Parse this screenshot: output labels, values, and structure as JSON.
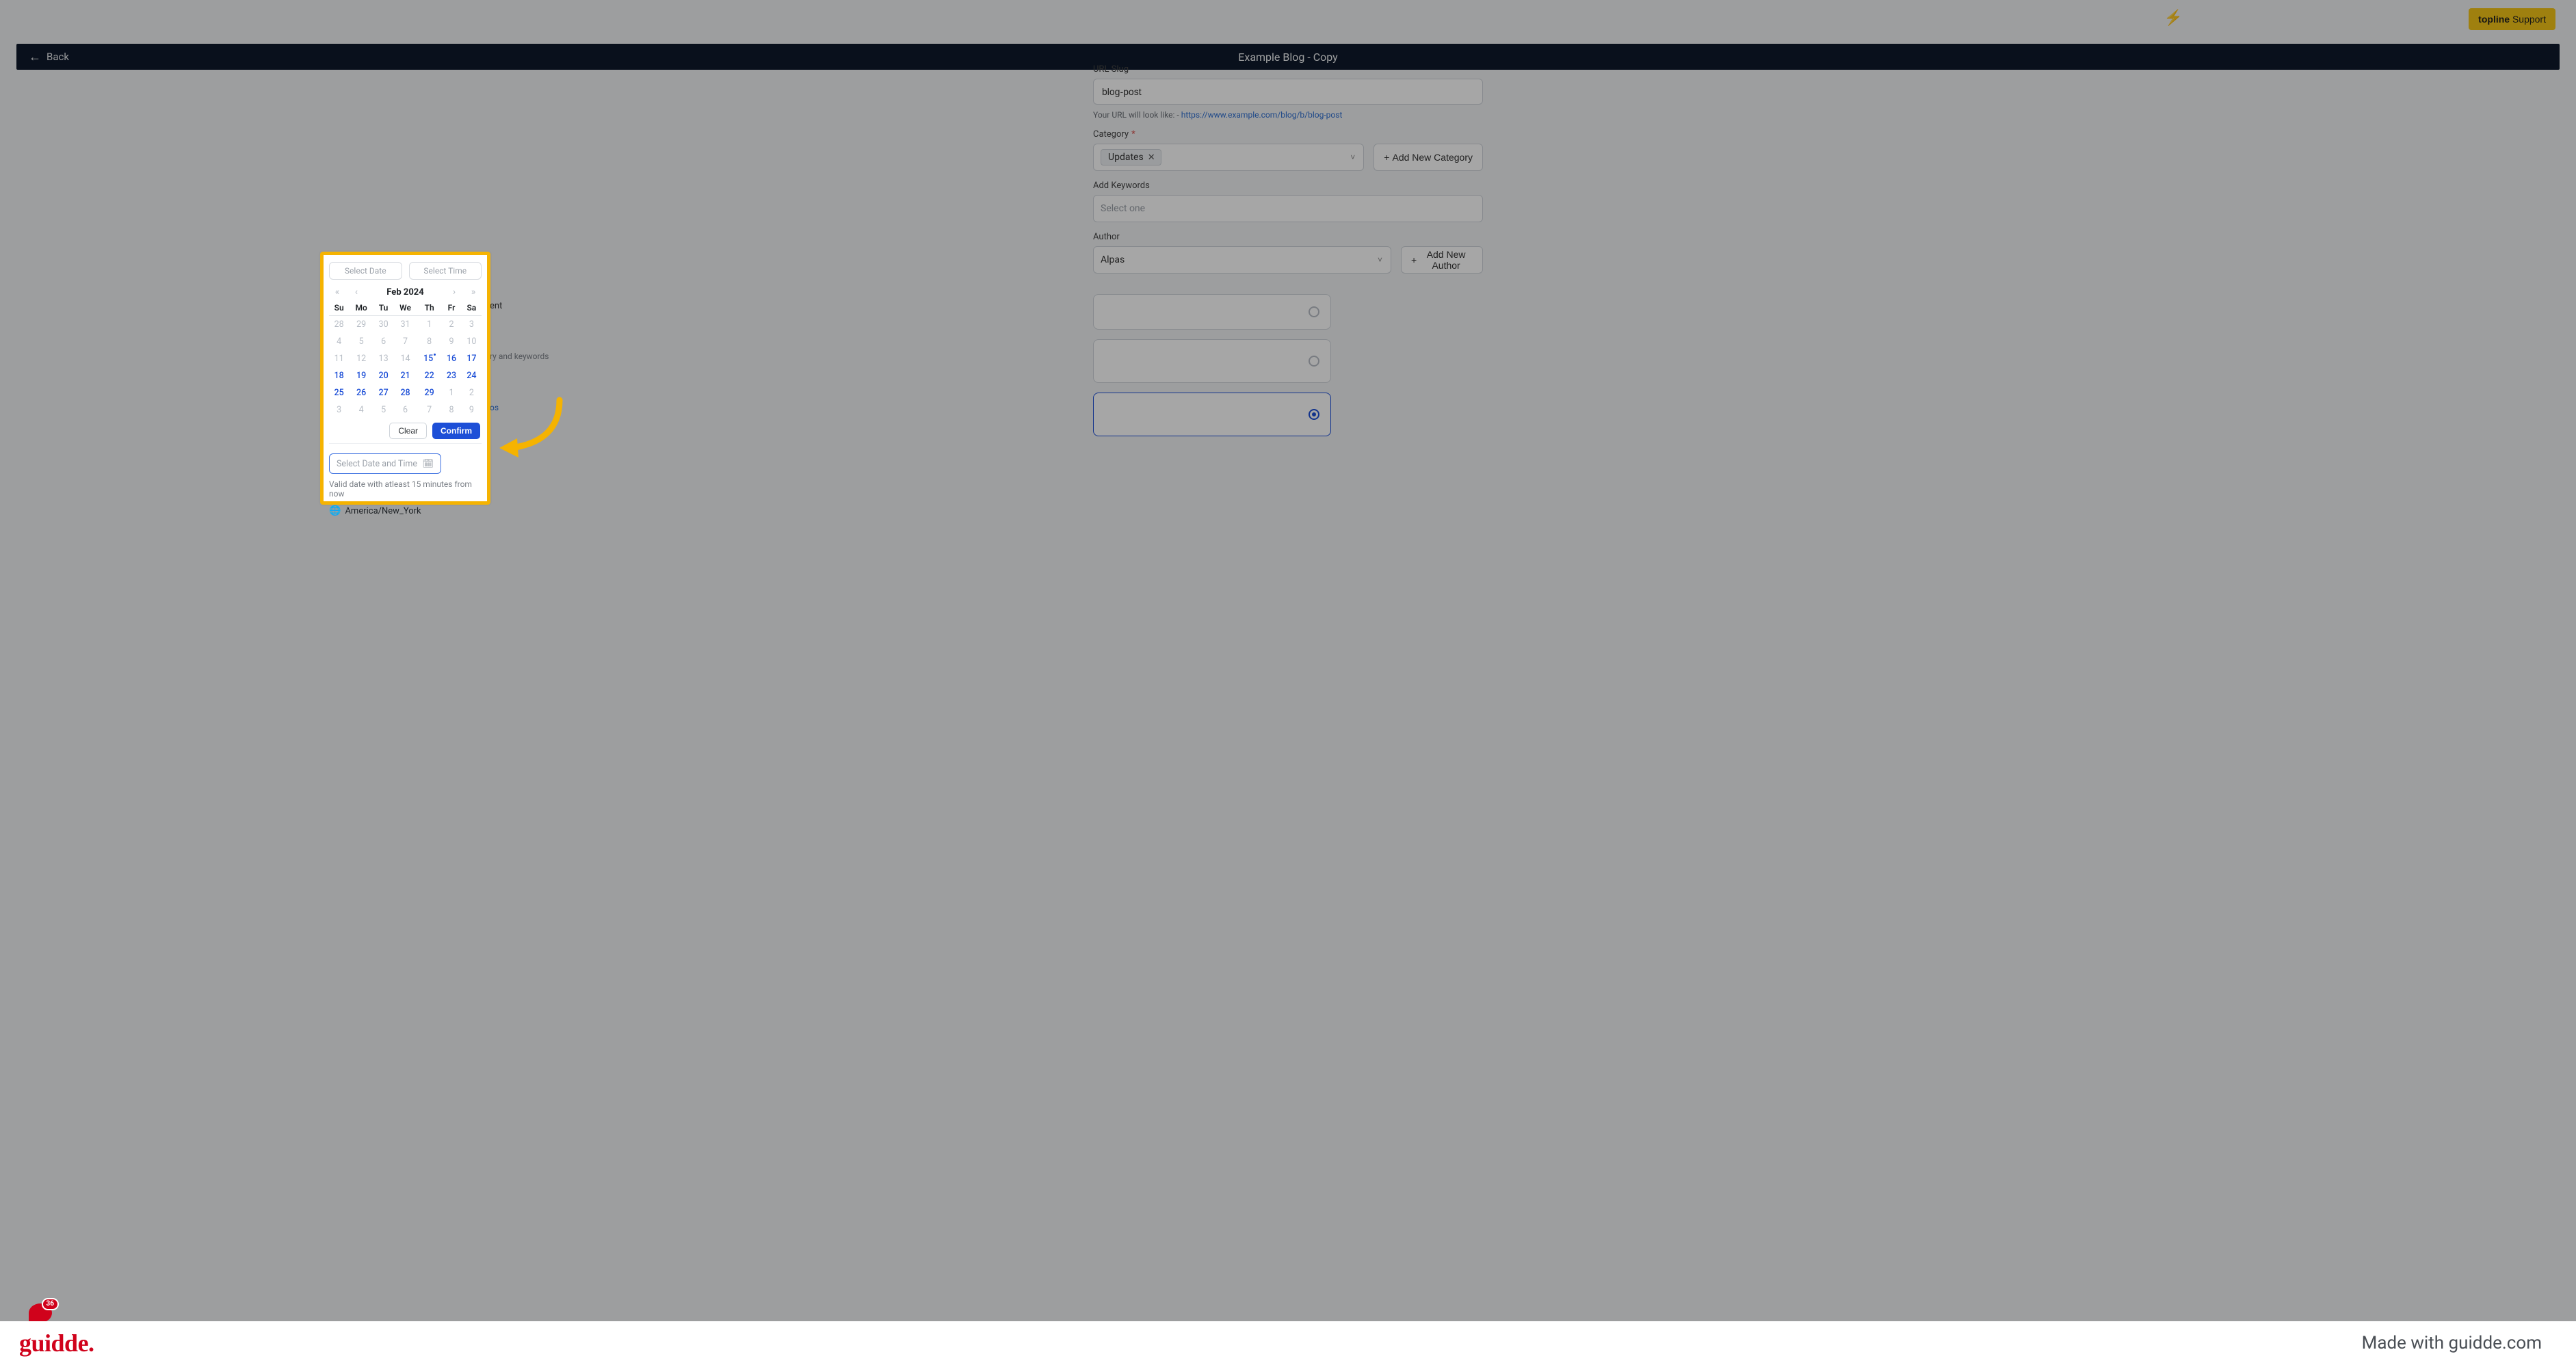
{
  "topbar": {
    "support_label_bold": "topline",
    "support_label_rest": " Support"
  },
  "header": {
    "back_label": "Back",
    "title": "Example Blog - Copy"
  },
  "form": {
    "url_slug_label": "URL Slug",
    "url_slug_value": "blog-post",
    "url_help_prefix": "Your URL will look like: - ",
    "url_help_link": "https://www.example.com/blog/b/blog-post",
    "category_label": "Category",
    "category_chip": "Updates",
    "add_category_btn": "Add New Category",
    "keywords_label": "Add Keywords",
    "keywords_placeholder": "Select one",
    "author_label": "Author",
    "author_value": "Alpas",
    "add_author_btn": "Add New Author",
    "radio_behind1_fragment": "ent",
    "radio_behind2_fragment": "ry and keywords",
    "radio_behind3_fragment": "os"
  },
  "datepicker": {
    "select_date_placeholder": "Select Date",
    "select_time_placeholder": "Select Time",
    "month_title": "Feb 2024",
    "dow": [
      "Su",
      "Mo",
      "Tu",
      "We",
      "Th",
      "Fr",
      "Sa"
    ],
    "rows": [
      [
        {
          "d": "28",
          "m": true
        },
        {
          "d": "29",
          "m": true
        },
        {
          "d": "30",
          "m": true
        },
        {
          "d": "31",
          "m": true
        },
        {
          "d": "1",
          "m": true
        },
        {
          "d": "2",
          "m": true
        },
        {
          "d": "3",
          "m": true
        }
      ],
      [
        {
          "d": "4",
          "m": true
        },
        {
          "d": "5",
          "m": true
        },
        {
          "d": "6",
          "m": true
        },
        {
          "d": "7",
          "m": true
        },
        {
          "d": "8",
          "m": true
        },
        {
          "d": "9",
          "m": true
        },
        {
          "d": "10",
          "m": true
        }
      ],
      [
        {
          "d": "11",
          "m": true
        },
        {
          "d": "12",
          "m": true
        },
        {
          "d": "13",
          "m": true
        },
        {
          "d": "14",
          "m": true
        },
        {
          "d": "15",
          "a": true,
          "mark": true
        },
        {
          "d": "16",
          "a": true
        },
        {
          "d": "17",
          "a": true
        }
      ],
      [
        {
          "d": "18",
          "a": true
        },
        {
          "d": "19",
          "a": true
        },
        {
          "d": "20",
          "a": true
        },
        {
          "d": "21",
          "a": true
        },
        {
          "d": "22",
          "a": true
        },
        {
          "d": "23",
          "a": true
        },
        {
          "d": "24",
          "a": true
        }
      ],
      [
        {
          "d": "25",
          "a": true
        },
        {
          "d": "26",
          "a": true
        },
        {
          "d": "27",
          "a": true
        },
        {
          "d": "28",
          "a": true
        },
        {
          "d": "29",
          "a": true
        },
        {
          "d": "1",
          "m": true
        },
        {
          "d": "2",
          "m": true
        }
      ],
      [
        {
          "d": "3",
          "m": true
        },
        {
          "d": "4",
          "m": true
        },
        {
          "d": "5",
          "m": true
        },
        {
          "d": "6",
          "m": true
        },
        {
          "d": "7",
          "m": true
        },
        {
          "d": "8",
          "m": true
        },
        {
          "d": "9",
          "m": true
        }
      ]
    ],
    "clear_btn": "Clear",
    "confirm_btn": "Confirm",
    "datetime_input_placeholder": "Select Date and Time",
    "valid_note": "Valid date with atleast 15 minutes from now",
    "timezone": "America/New_York"
  },
  "chat": {
    "count": "36"
  },
  "footer": {
    "brand": "guidde",
    "madewith": "Made with guidde.com"
  }
}
